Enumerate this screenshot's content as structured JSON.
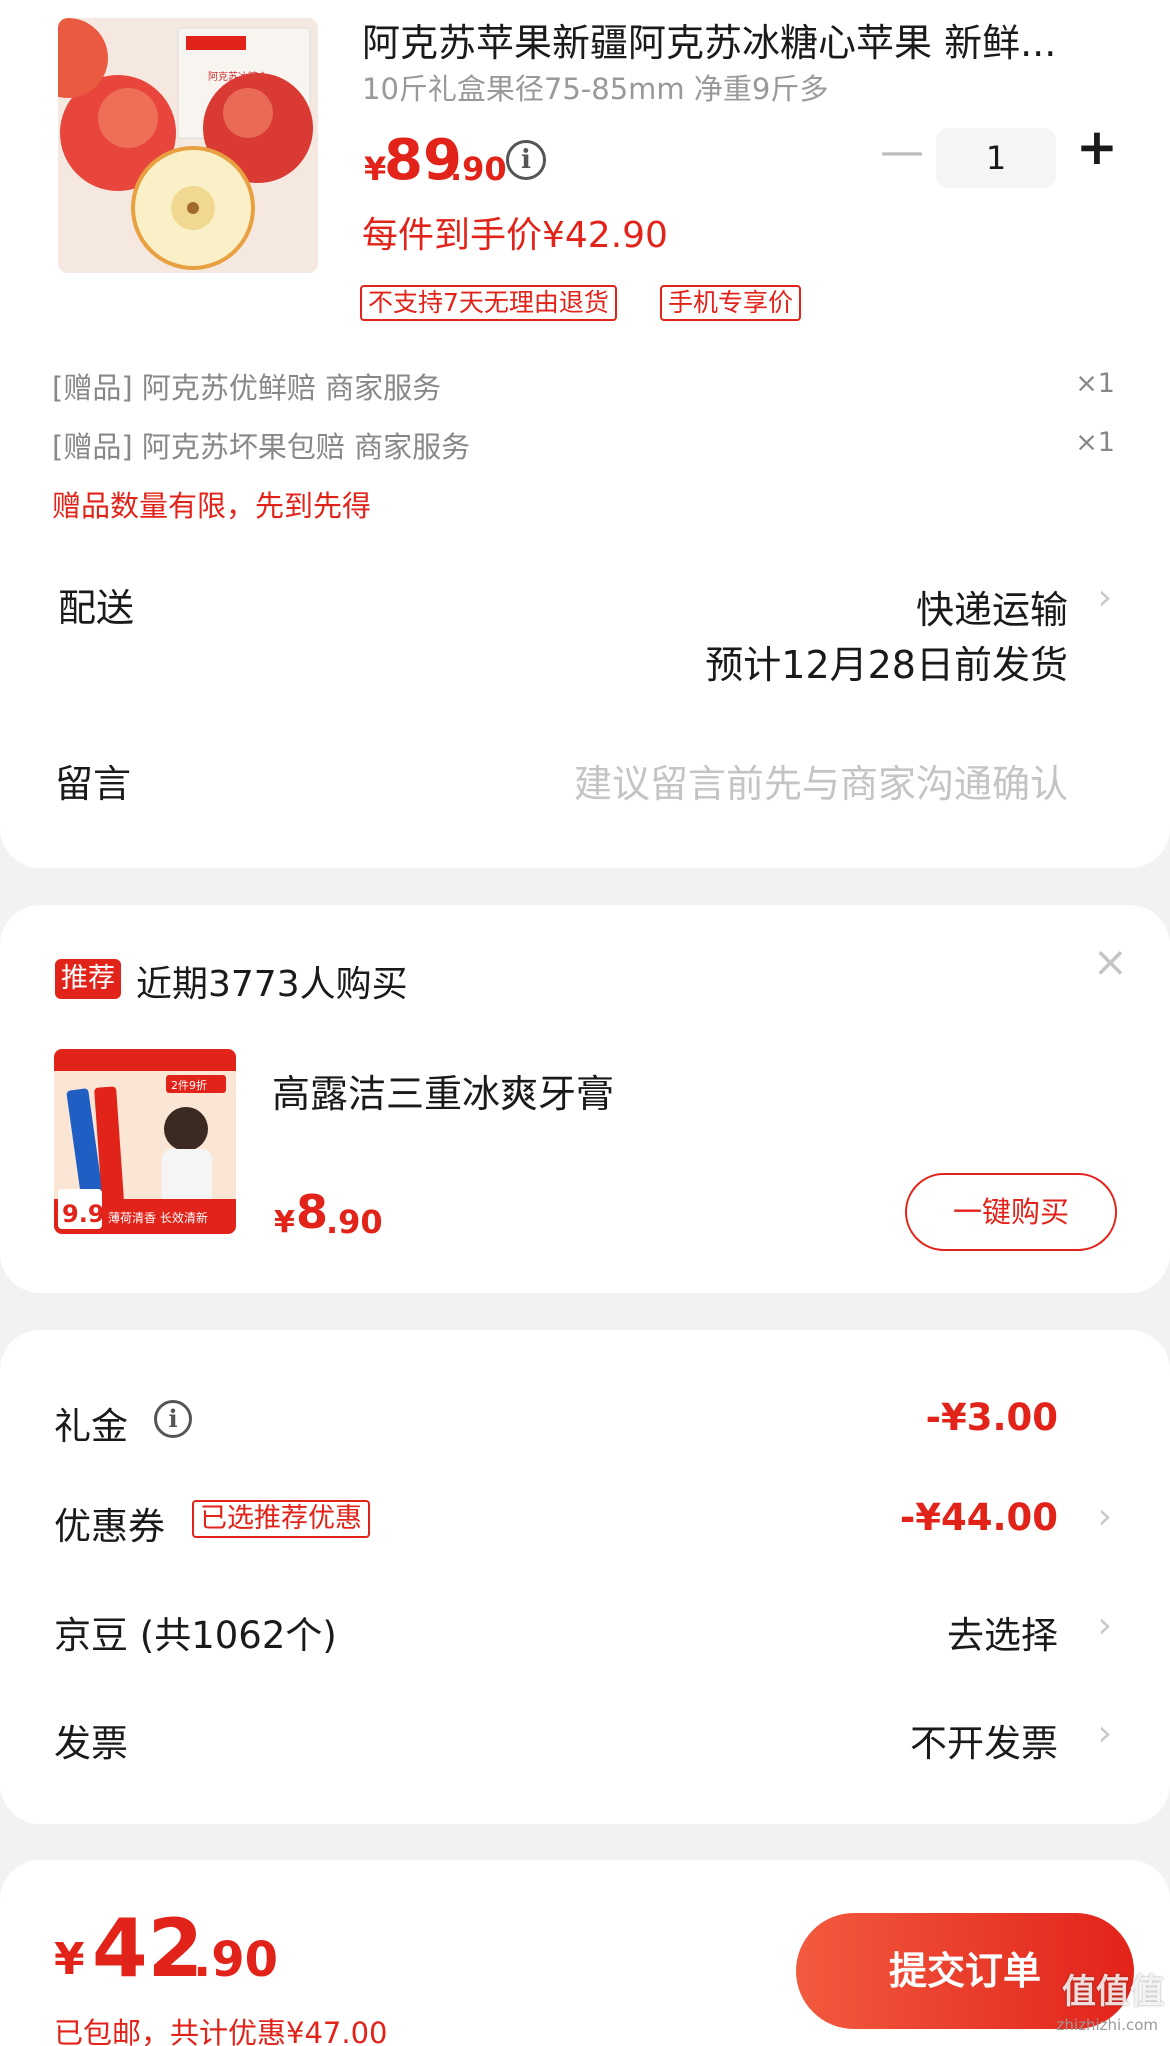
{
  "product": {
    "title": "阿克苏苹果新疆阿克苏冰糖心苹果 新鲜...",
    "spec": "10斤礼盒果径75-85mm 净重9斤多",
    "price_yen": "¥",
    "price_int": "89",
    "price_dec": ".90",
    "info_icon_glyph": "i",
    "minus": "—",
    "quantity": "1",
    "plus": "+",
    "hand_price": "每件到手价¥42.90",
    "tags": [
      "不支持7天无理由退货",
      "手机专享价"
    ],
    "image_box_text": [
      "阿克苏冰糖心"
    ]
  },
  "gifts": [
    {
      "label": "[赠品] 阿克苏优鲜赔 商家服务",
      "qty": "×1"
    },
    {
      "label": "[赠品] 阿克苏坏果包赔 商家服务",
      "qty": "×1"
    }
  ],
  "gift_note": "赠品数量有限，先到先得",
  "shipping": {
    "label": "配送",
    "method": "快递运输",
    "date": "预计12月28日前发货"
  },
  "message": {
    "label": "留言",
    "placeholder": "建议留言前先与商家沟通确认"
  },
  "recommend": {
    "badge": "推荐",
    "title": "近期3773人购买",
    "close": "×",
    "name": "高露洁三重冰爽牙膏",
    "price_yen": "¥",
    "price_int": "8",
    "price_dec": ".90",
    "buy_button": "一键购买",
    "image_text": {
      "promo": "2件9折",
      "price": "9.9",
      "slogan": "薄荷清香 长效清新"
    }
  },
  "discounts": {
    "gift_money_label": "礼金",
    "gift_money_value": "-¥3.00",
    "coupon_label": "优惠券",
    "coupon_tag": "已选推荐优惠",
    "coupon_value": "-¥44.00",
    "jingdou_label": "京豆 (共1062个)",
    "jingdou_value": "去选择",
    "invoice_label": "发票",
    "invoice_value": "不开发票"
  },
  "footer": {
    "total_yen": "¥",
    "total_int": "42",
    "total_dec": ".90",
    "note": "已包邮，共计优惠¥47.00",
    "submit": "提交订单",
    "watermark": "值值值",
    "watermark_url": "zhizhizhi.com"
  },
  "colors": {
    "accent": "#e2231a",
    "background": "#f2f2f2"
  }
}
